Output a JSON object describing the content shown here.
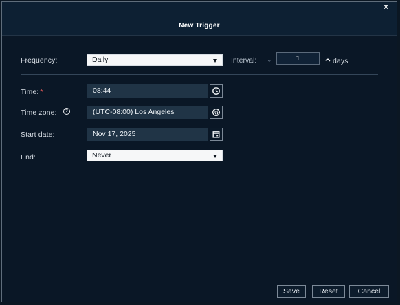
{
  "dialog": {
    "title": "New Trigger",
    "close_label": "×"
  },
  "frequency": {
    "label": "Frequency:",
    "value": "Daily",
    "interval_label": "Interval:",
    "interval_value": "1",
    "stepper_label": "^",
    "unit": "days"
  },
  "time": {
    "label": "Time:",
    "required_mark": "*",
    "value": "08:44",
    "icon": "clock-icon"
  },
  "timezone": {
    "label": "Time zone:",
    "help_icon_text": "?",
    "value": "(UTC-08:00) Los Angeles",
    "icon": "globe-icon"
  },
  "start_date": {
    "label": "Start date:",
    "value": "Nov 17, 2025",
    "icon": "calendar-icon"
  },
  "end": {
    "label": "End:",
    "value": "Never"
  },
  "buttons": {
    "save": "Save",
    "reset": "Reset",
    "cancel": "Cancel"
  },
  "colors": {
    "background": "#0a1726",
    "titlebar": "#0d2033",
    "field": "#203446",
    "text": "#d8dee5",
    "required": "#e35a5a"
  }
}
